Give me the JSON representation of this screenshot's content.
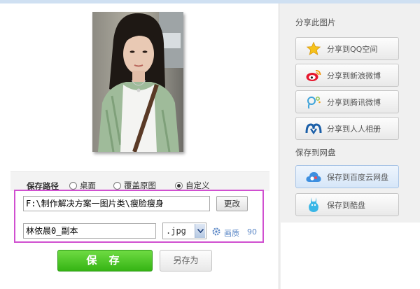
{
  "save_path": {
    "label": "保存路径",
    "options": [
      {
        "label": "桌面",
        "checked": false
      },
      {
        "label": "覆盖原图",
        "checked": false
      },
      {
        "label": "自定义",
        "checked": true
      }
    ],
    "path_value": "F:\\制作解决方案一图片类\\瘦脸瘦身",
    "change_button": "更改",
    "filename_value": "林依晨0_副本",
    "format_value": ".jpg",
    "quality_label": "画质",
    "quality_value": "90"
  },
  "actions": {
    "save_label": "保 存",
    "save_as_label": "另存为"
  },
  "sidebar": {
    "share_title": "分享此图片",
    "share_items": [
      {
        "label": "分享到QQ空间",
        "icon": "star-icon"
      },
      {
        "label": "分享到新浪微博",
        "icon": "weibo-icon"
      },
      {
        "label": "分享到腾讯微博",
        "icon": "tencent-weibo-icon"
      },
      {
        "label": "分享到人人相册",
        "icon": "renren-icon"
      }
    ],
    "cloud_title": "保存到网盘",
    "cloud_items": [
      {
        "label": "保存到百度云网盘",
        "icon": "baidu-cloud-icon"
      },
      {
        "label": "保存到酷盘",
        "icon": "kupan-icon"
      }
    ]
  },
  "colors": {
    "save_green": "#35b414",
    "highlight_border": "#d04fd0",
    "link_blue": "#5b87c6"
  }
}
